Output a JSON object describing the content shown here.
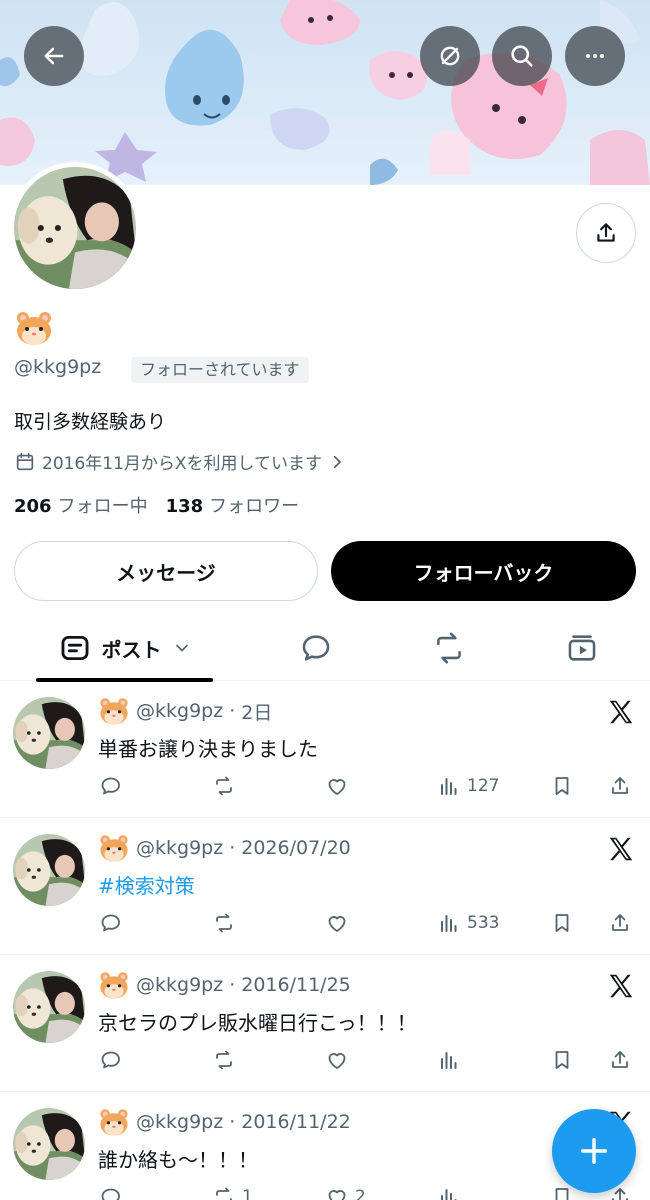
{
  "profile": {
    "handle": "@kkg9pz",
    "follows_you_badge": "フォローされています",
    "bio": "取引多数経験あり",
    "joined": "2016年11月からXを利用しています",
    "following_count": "206",
    "following_label": "フォロー中",
    "followers_count": "138",
    "followers_label": "フォロワー"
  },
  "buttons": {
    "message": "メッセージ",
    "follow_back": "フォローバック"
  },
  "tabs": {
    "active_label": "ポスト"
  },
  "posts": [
    {
      "handle": "@kkg9pz",
      "date": "2日",
      "text": "単番お譲り決まりました",
      "is_link": false,
      "views": "127",
      "replies": "",
      "reposts": "",
      "likes": ""
    },
    {
      "handle": "@kkg9pz",
      "date": "2026/07/20",
      "text": "#検索対策",
      "is_link": true,
      "views": "533",
      "replies": "",
      "reposts": "",
      "likes": ""
    },
    {
      "handle": "@kkg9pz",
      "date": "2016/11/25",
      "text": "京セラのプレ販水曜日行こっ！！！",
      "is_link": false,
      "views": "",
      "replies": "",
      "reposts": "",
      "likes": ""
    },
    {
      "handle": "@kkg9pz",
      "date": "2016/11/22",
      "text": "誰か絡も〜！！！",
      "is_link": false,
      "views": "",
      "replies": "",
      "reposts": "1",
      "likes": "2"
    }
  ],
  "separator": "·",
  "colors": {
    "link": "#1d9bf0",
    "fab": "#1d9bf0",
    "muted": "#536471"
  },
  "icons": [
    "back-arrow-icon",
    "translate-icon",
    "search-icon",
    "more-icon",
    "share-icon",
    "calendar-icon",
    "chevron-right-icon",
    "post-tab-icon",
    "reply-icon",
    "repost-icon",
    "like-icon",
    "views-icon",
    "bookmark-icon",
    "x-logo-icon",
    "plus-icon",
    "media-tab-icon"
  ]
}
